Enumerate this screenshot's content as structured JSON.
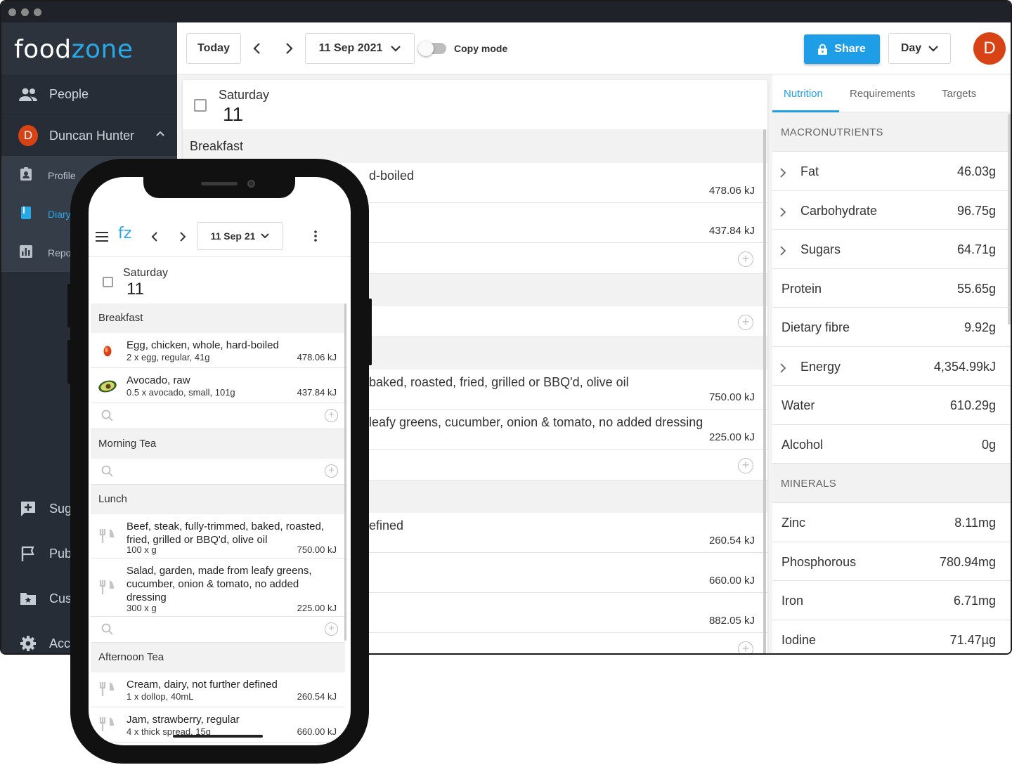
{
  "app": {
    "logo_part1": "food",
    "logo_part2": "zone",
    "mobile_logo": "fz"
  },
  "colors": {
    "accent": "#1e9ee6",
    "sidebar_bg": "#262d36",
    "avatar_bg": "#d84315"
  },
  "sidebar": {
    "people_label": "People",
    "user_initial": "D",
    "user_name": "Duncan Hunter",
    "sub_items": [
      {
        "label": "Profile",
        "icon": "profile-icon"
      },
      {
        "label": "Diary",
        "icon": "diary-icon",
        "active": true
      },
      {
        "label": "Repo",
        "icon": "reports-icon"
      }
    ],
    "bottom_items": [
      {
        "label": "Sug",
        "icon": "suggest-icon"
      },
      {
        "label": "Pub",
        "icon": "flag-icon"
      },
      {
        "label": "Cus",
        "icon": "custom-folder-icon"
      },
      {
        "label": "Acc",
        "icon": "gear-icon"
      }
    ]
  },
  "toolbar": {
    "today_label": "Today",
    "date_label": "11 Sep 2021",
    "copy_mode_label": "Copy mode",
    "share_label": "Share",
    "view_label": "Day",
    "avatar_initial": "D"
  },
  "diary": {
    "day_name": "Saturday",
    "day_number": "11",
    "breakfast_label": "Breakfast",
    "rows": [
      {
        "text": "d-boiled",
        "kj": "478.06 kJ"
      },
      {
        "text": "",
        "kj": "437.84 kJ"
      },
      {
        "text": "baked, roasted, fried, grilled or BBQ'd, olive oil",
        "kj": "750.00 kJ"
      },
      {
        "text": "leafy greens, cucumber, onion & tomato, no added dressing",
        "kj": "225.00 kJ"
      },
      {
        "text": "efined",
        "kj": "260.54 kJ"
      },
      {
        "text": "",
        "kj": "660.00 kJ"
      },
      {
        "text": "",
        "kj": "882.05 kJ"
      }
    ]
  },
  "nutrition_panel": {
    "tabs": [
      "Nutrition",
      "Requirements",
      "Targets"
    ],
    "macro_header": "MACRONUTRIENTS",
    "macros": [
      {
        "label": "Fat",
        "value": "46.03g",
        "expandable": true
      },
      {
        "label": "Carbohydrate",
        "value": "96.75g",
        "expandable": true
      },
      {
        "label": "Sugars",
        "value": "64.71g",
        "expandable": true
      },
      {
        "label": "Protein",
        "value": "55.65g",
        "expandable": false
      },
      {
        "label": "Dietary fibre",
        "value": "9.92g",
        "expandable": false
      },
      {
        "label": "Energy",
        "value": "4,354.99kJ",
        "expandable": true
      },
      {
        "label": "Water",
        "value": "610.29g",
        "expandable": false
      },
      {
        "label": "Alcohol",
        "value": "0g",
        "expandable": false
      }
    ],
    "minerals_header": "MINERALS",
    "minerals": [
      {
        "label": "Zinc",
        "value": "8.11mg"
      },
      {
        "label": "Phosphorous",
        "value": "780.94mg"
      },
      {
        "label": "Iron",
        "value": "6.71mg"
      },
      {
        "label": "Iodine",
        "value": "71.47µg"
      }
    ]
  },
  "mobile": {
    "date_label": "11 Sep 21",
    "day_name": "Saturday",
    "day_number": "11",
    "meals": {
      "breakfast": "Breakfast",
      "morning_tea": "Morning Tea",
      "lunch": "Lunch",
      "afternoon_tea": "Afternoon Tea"
    },
    "breakfast_items": [
      {
        "name": "Egg, chicken, whole, hard-boiled",
        "qty": "2 x egg, regular, 41g",
        "kj": "478.06 kJ",
        "icon": "egg-icon"
      },
      {
        "name": "Avocado, raw",
        "qty": "0.5 x avocado, small, 101g",
        "kj": "437.84 kJ",
        "icon": "avocado-icon"
      }
    ],
    "lunch_items": [
      {
        "name": "Beef, steak, fully-trimmed, baked, roasted, fried, grilled or BBQ'd, olive oil",
        "qty": "100 x g",
        "kj": "750.00 kJ",
        "icon": "cutlery-icon"
      },
      {
        "name": "Salad, garden, made from leafy greens, cucumber, onion & tomato, no added dressing",
        "qty": "300 x g",
        "kj": "225.00 kJ",
        "icon": "cutlery-icon"
      }
    ],
    "afternoon_items": [
      {
        "name": "Cream, dairy, not further defined",
        "qty": "1 x dollop, 40mL",
        "kj": "260.54 kJ",
        "icon": "cutlery-icon"
      },
      {
        "name": "Jam, strawberry, regular",
        "qty": "4 x thick spread, 15g",
        "kj": "660.00 kJ",
        "icon": "cutlery-icon"
      }
    ]
  }
}
